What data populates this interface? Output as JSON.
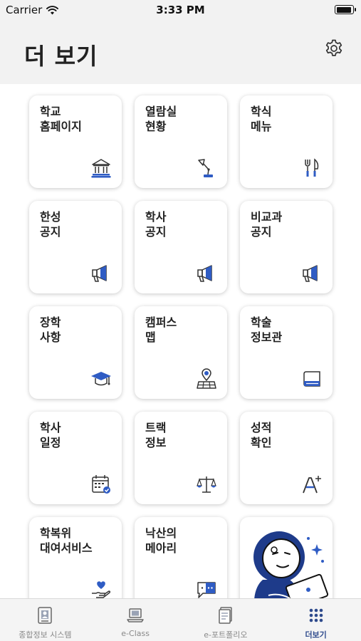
{
  "status": {
    "carrier": "Carrier",
    "time": "3:33 PM"
  },
  "header": {
    "title": "더 보기",
    "settings_icon": "gear-icon"
  },
  "accent_color": "#2f5cc4",
  "tiles": [
    {
      "line1": "학교",
      "line2": "홈페이지",
      "icon": "university-building-icon"
    },
    {
      "line1": "열람실",
      "line2": "현황",
      "icon": "desk-lamp-icon"
    },
    {
      "line1": "학식",
      "line2": "메뉴",
      "icon": "fork-knife-icon"
    },
    {
      "line1": "한성",
      "line2": "공지",
      "icon": "megaphone-icon"
    },
    {
      "line1": "학사",
      "line2": "공지",
      "icon": "megaphone-icon"
    },
    {
      "line1": "비교과",
      "line2": "공지",
      "icon": "megaphone-icon"
    },
    {
      "line1": "장학",
      "line2": "사항",
      "icon": "graduation-cap-icon"
    },
    {
      "line1": "캠퍼스",
      "line2": "맵",
      "icon": "map-pin-icon"
    },
    {
      "line1": "학술",
      "line2": "정보관",
      "icon": "book-icon"
    },
    {
      "line1": "학사",
      "line2": "일정",
      "icon": "calendar-icon"
    },
    {
      "line1": "트랙",
      "line2": "정보",
      "icon": "balance-scale-icon"
    },
    {
      "line1": "성적",
      "line2": "확인",
      "icon": "grade-a-plus-icon"
    },
    {
      "line1": "학복위",
      "line2": "대여서비스",
      "icon": "heart-hand-icon"
    },
    {
      "line1": "낙산의",
      "line2": "메아리",
      "icon": "chat-bubble-icon"
    },
    {
      "line1": "",
      "line2": "",
      "icon": "mascot-illustration"
    }
  ],
  "tabbar": {
    "items": [
      {
        "label": "종합정보 시스템",
        "icon": "id-card-icon"
      },
      {
        "label": "e-Class",
        "icon": "laptop-icon"
      },
      {
        "label": "e-포트폴리오",
        "icon": "document-icon"
      },
      {
        "label": "더보기",
        "icon": "grid-dots-icon",
        "active": true
      }
    ]
  }
}
